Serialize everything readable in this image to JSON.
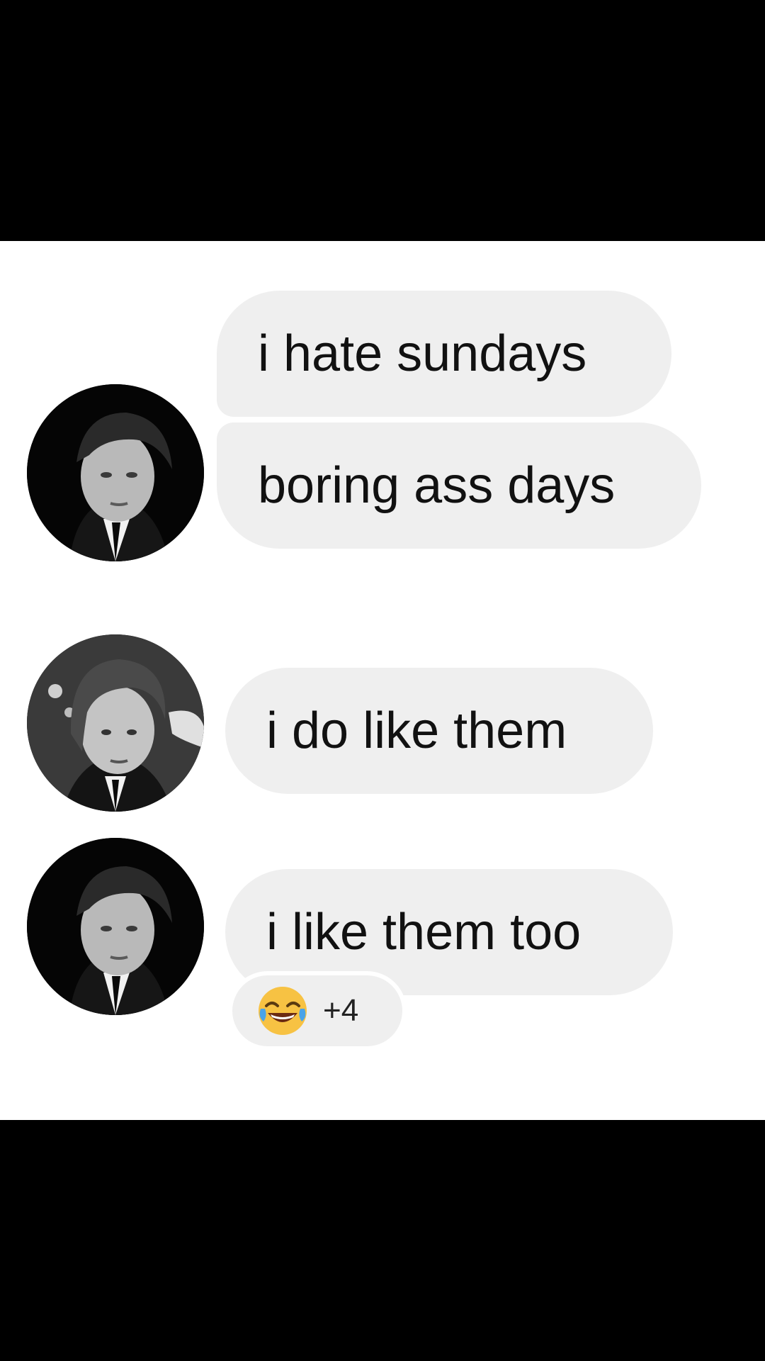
{
  "conversation": {
    "messages": [
      {
        "sender": "avatar-1",
        "text": "i hate sundays"
      },
      {
        "sender": "avatar-1",
        "text": "boring ass days"
      },
      {
        "sender": "avatar-2",
        "text": "i do like them"
      },
      {
        "sender": "avatar-3",
        "text": "i like them too"
      }
    ],
    "reaction": {
      "emoji": "face-with-tears-of-joy-icon",
      "count": "+4"
    }
  },
  "colors": {
    "bubble": "#efefef",
    "text": "#111111",
    "background": "#ffffff",
    "letterbox": "#000000"
  }
}
